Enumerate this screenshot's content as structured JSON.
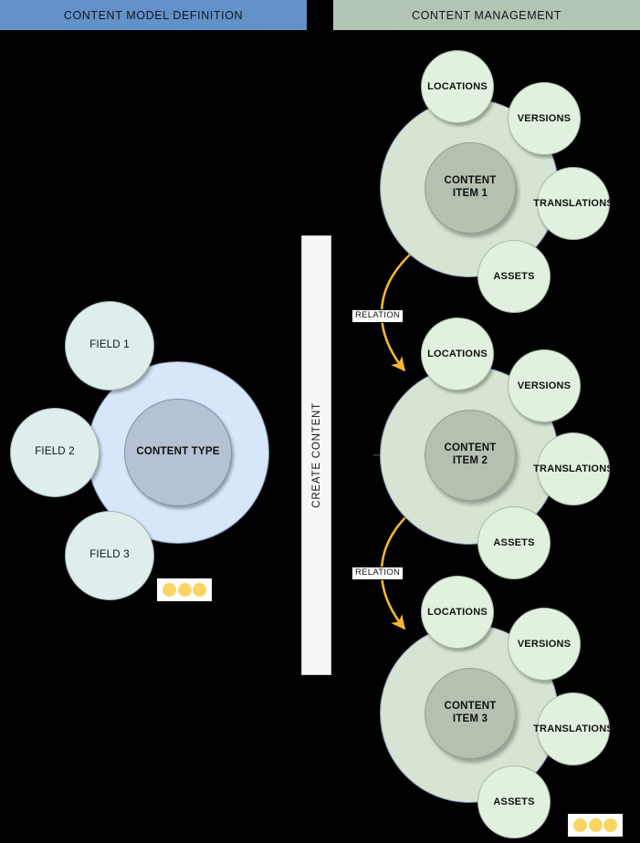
{
  "headers": {
    "model": "CONTENT MODEL DEFINITION",
    "management": "CONTENT MANAGEMENT"
  },
  "left_panel": {
    "content_type_label": "CONTENT TYPE",
    "fields": [
      {
        "label": "FIELD 1"
      },
      {
        "label": "FIELD 2"
      },
      {
        "label": "FIELD 3"
      }
    ],
    "ellipsis": "three-dots"
  },
  "middle": {
    "create_content_label": "CREATE CONTENT"
  },
  "right_panel": {
    "items": [
      {
        "title_line1": "CONTENT",
        "title_line2": "ITEM 1",
        "satellites": [
          "LOCATIONS",
          "VERSIONS",
          "TRANSLATIONS",
          "ASSETS"
        ]
      },
      {
        "title_line1": "CONTENT",
        "title_line2": "ITEM 2",
        "satellites": [
          "LOCATIONS",
          "VERSIONS",
          "TRANSLATIONS",
          "ASSETS"
        ]
      },
      {
        "title_line1": "CONTENT",
        "title_line2": "ITEM 3",
        "satellites": [
          "LOCATIONS",
          "VERSIONS",
          "TRANSLATIONS",
          "ASSETS"
        ]
      }
    ],
    "relations": [
      {
        "label": "RELATION"
      },
      {
        "label": "RELATION"
      }
    ],
    "ellipsis": "three-dots"
  },
  "colors": {
    "header_model": "#6292c8",
    "header_management": "#b2c4b3",
    "content_type_outer": "#d7e6f8",
    "content_type_inner": "#b5c2d3",
    "field_circle": "#dfeeec",
    "content_item_outer": "#d7e4d3",
    "content_item_inner": "#b4c1b0",
    "satellite_circle": "#e2f1df",
    "relation_arrow": "#f5b731",
    "create_arrow": "#333333",
    "dot": "#fcd462",
    "background": "#000000"
  }
}
